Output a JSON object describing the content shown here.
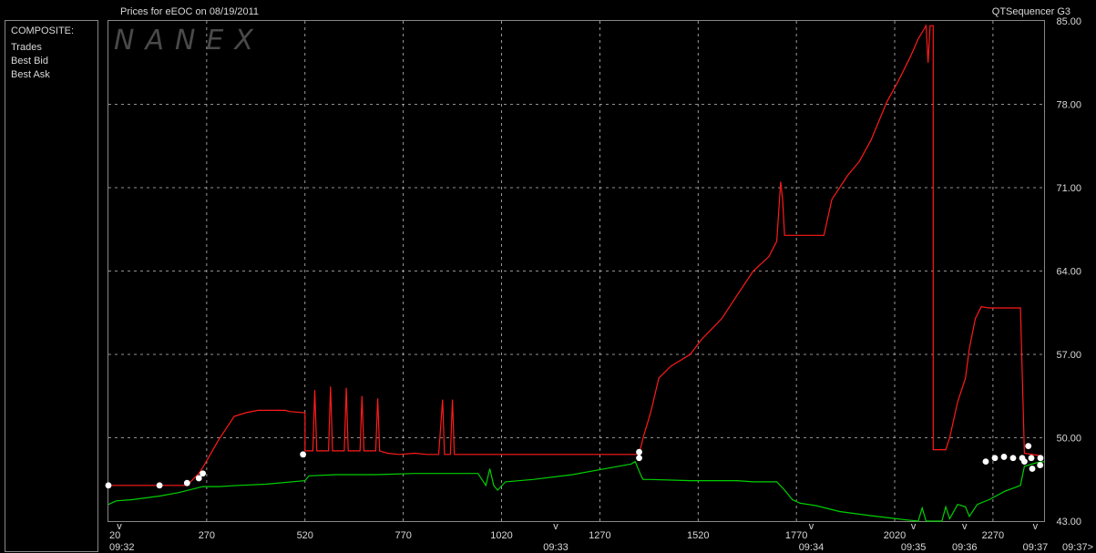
{
  "header": {
    "title": "Prices for  eEOC  on  08/19/2011",
    "right_label": "QTSequencer G3"
  },
  "watermark": "NANEX",
  "legend": {
    "heading": "COMPOSITE:",
    "items": [
      {
        "label": "Trades",
        "color": "#ffffff"
      },
      {
        "label": "Best Bid",
        "color": "#00e000"
      },
      {
        "label": "Best Ask",
        "color": "#ff2020"
      }
    ]
  },
  "colors": {
    "background": "#000000",
    "grid": "#c0c0c0",
    "trades": "#ffffff",
    "bid": "#00d000",
    "ask": "#ff1a1a"
  },
  "chart_data": {
    "type": "line",
    "xlim": [
      20,
      2400
    ],
    "ylim": [
      43,
      85
    ],
    "x_ticks": [
      20,
      270,
      520,
      770,
      1020,
      1270,
      1520,
      1770,
      2020,
      2270
    ],
    "x_tick_labels": [
      "20",
      "270",
      "520",
      "770",
      "1020",
      "1270",
      "1520",
      "1770",
      "2020",
      "2270"
    ],
    "y_ticks": [
      43,
      50,
      57,
      64,
      71,
      78,
      85
    ],
    "y_tick_labels": [
      "43.00",
      "50.00",
      "57.00",
      "64.00",
      "71.00",
      "78.00",
      "85.00"
    ],
    "time_marks": [
      {
        "x": 20,
        "label": "09:32"
      },
      {
        "x": 1130,
        "label": "09:33"
      },
      {
        "x": 1780,
        "label": "09:34"
      },
      {
        "x": 2040,
        "label": "09:35"
      },
      {
        "x": 2170,
        "label": "09:36"
      },
      {
        "x": 2350,
        "label": "09:37"
      },
      {
        "x": 2400,
        "label": "09:37>"
      }
    ],
    "series": [
      {
        "name": "Best Ask",
        "color": "#ff1a1a",
        "points": [
          [
            20,
            46
          ],
          [
            220,
            46
          ],
          [
            250,
            47
          ],
          [
            260,
            47.5
          ],
          [
            300,
            49.8
          ],
          [
            340,
            51.8
          ],
          [
            370,
            52.1
          ],
          [
            400,
            52.3
          ],
          [
            430,
            52.3
          ],
          [
            470,
            52.3
          ],
          [
            480,
            52.2
          ],
          [
            520,
            52.1
          ],
          [
            520,
            48.9
          ],
          [
            540,
            48.9
          ],
          [
            545,
            54
          ],
          [
            550,
            48.9
          ],
          [
            580,
            48.9
          ],
          [
            585,
            54.3
          ],
          [
            590,
            48.9
          ],
          [
            620,
            48.9
          ],
          [
            625,
            54.2
          ],
          [
            630,
            48.9
          ],
          [
            660,
            48.9
          ],
          [
            665,
            53.5
          ],
          [
            670,
            48.9
          ],
          [
            700,
            48.9
          ],
          [
            705,
            53.3
          ],
          [
            710,
            48.9
          ],
          [
            730,
            48.7
          ],
          [
            760,
            48.6
          ],
          [
            800,
            48.7
          ],
          [
            830,
            48.6
          ],
          [
            860,
            48.6
          ],
          [
            870,
            53.2
          ],
          [
            875,
            48.6
          ],
          [
            890,
            48.6
          ],
          [
            895,
            53.2
          ],
          [
            900,
            48.6
          ],
          [
            960,
            48.6
          ],
          [
            1000,
            48.6
          ],
          [
            1370,
            48.6
          ],
          [
            1380,
            50
          ],
          [
            1400,
            52.2
          ],
          [
            1420,
            55
          ],
          [
            1450,
            56
          ],
          [
            1500,
            57
          ],
          [
            1530,
            58.3
          ],
          [
            1580,
            60
          ],
          [
            1620,
            62
          ],
          [
            1660,
            64
          ],
          [
            1700,
            65.2
          ],
          [
            1720,
            66.5
          ],
          [
            1730,
            71.5
          ],
          [
            1735,
            70
          ],
          [
            1740,
            67
          ],
          [
            1750,
            67
          ],
          [
            1800,
            67
          ],
          [
            1840,
            67
          ],
          [
            1860,
            70
          ],
          [
            1900,
            72
          ],
          [
            1930,
            73.2
          ],
          [
            1960,
            75
          ],
          [
            2000,
            78.2
          ],
          [
            2030,
            80
          ],
          [
            2060,
            82
          ],
          [
            2080,
            83.5
          ],
          [
            2100,
            84.6
          ],
          [
            2105,
            81.5
          ],
          [
            2110,
            84.6
          ],
          [
            2118,
            84.6
          ],
          [
            2118,
            49
          ],
          [
            2150,
            49
          ],
          [
            2160,
            50
          ],
          [
            2180,
            53
          ],
          [
            2200,
            55
          ],
          [
            2210,
            57.5
          ],
          [
            2225,
            60
          ],
          [
            2240,
            61
          ],
          [
            2260,
            60.9
          ],
          [
            2300,
            60.9
          ],
          [
            2340,
            60.9
          ],
          [
            2350,
            48.7
          ],
          [
            2390,
            48.5
          ]
        ]
      },
      {
        "name": "Best Bid",
        "color": "#00d000",
        "points": [
          [
            20,
            44.4
          ],
          [
            40,
            44.7
          ],
          [
            80,
            44.8
          ],
          [
            150,
            45.1
          ],
          [
            200,
            45.4
          ],
          [
            260,
            45.9
          ],
          [
            300,
            45.9
          ],
          [
            350,
            46.0
          ],
          [
            420,
            46.1
          ],
          [
            520,
            46.4
          ],
          [
            530,
            46.8
          ],
          [
            600,
            46.9
          ],
          [
            700,
            46.9
          ],
          [
            800,
            47.0
          ],
          [
            900,
            47.0
          ],
          [
            960,
            47.0
          ],
          [
            980,
            46.0
          ],
          [
            990,
            47.4
          ],
          [
            1000,
            46.0
          ],
          [
            1010,
            45.6
          ],
          [
            1030,
            46.3
          ],
          [
            1100,
            46.5
          ],
          [
            1200,
            46.9
          ],
          [
            1300,
            47.5
          ],
          [
            1350,
            47.8
          ],
          [
            1360,
            48.0
          ],
          [
            1375,
            46.8
          ],
          [
            1380,
            46.5
          ],
          [
            1400,
            46.5
          ],
          [
            1500,
            46.4
          ],
          [
            1580,
            46.4
          ],
          [
            1620,
            46.4
          ],
          [
            1660,
            46.3
          ],
          [
            1720,
            46.3
          ],
          [
            1740,
            45.6
          ],
          [
            1760,
            44.8
          ],
          [
            1780,
            44.5
          ],
          [
            1820,
            44.3
          ],
          [
            1880,
            43.8
          ],
          [
            1950,
            43.5
          ],
          [
            2000,
            43.3
          ],
          [
            2050,
            43.1
          ],
          [
            2080,
            43.0
          ],
          [
            2090,
            44.1
          ],
          [
            2100,
            43.0
          ],
          [
            2140,
            43.0
          ],
          [
            2150,
            44.2
          ],
          [
            2160,
            43.2
          ],
          [
            2180,
            44.4
          ],
          [
            2200,
            44.2
          ],
          [
            2210,
            43.4
          ],
          [
            2230,
            44.4
          ],
          [
            2260,
            44.8
          ],
          [
            2300,
            45.5
          ],
          [
            2340,
            46.0
          ],
          [
            2350,
            47.6
          ],
          [
            2360,
            47.7
          ],
          [
            2380,
            47.9
          ],
          [
            2400,
            48.0
          ]
        ]
      },
      {
        "name": "Trades",
        "color": "#ffffff",
        "points": [
          [
            20,
            46.0
          ],
          [
            150,
            46.0
          ],
          [
            220,
            46.2
          ],
          [
            250,
            46.6
          ],
          [
            260,
            47.0
          ],
          [
            515,
            48.6
          ],
          [
            1370,
            48.3
          ],
          [
            1370,
            48.8
          ],
          [
            2350,
            48.0
          ],
          [
            2360,
            49.3
          ],
          [
            2370,
            47.4
          ],
          [
            2390,
            47.7
          ],
          [
            2400,
            48.0
          ],
          [
            2420,
            48.3
          ],
          [
            2440,
            48.4
          ],
          [
            2460,
            48.3
          ],
          [
            2480,
            48.3
          ],
          [
            2500,
            48.3
          ],
          [
            2520,
            48.3
          ]
        ]
      }
    ]
  }
}
